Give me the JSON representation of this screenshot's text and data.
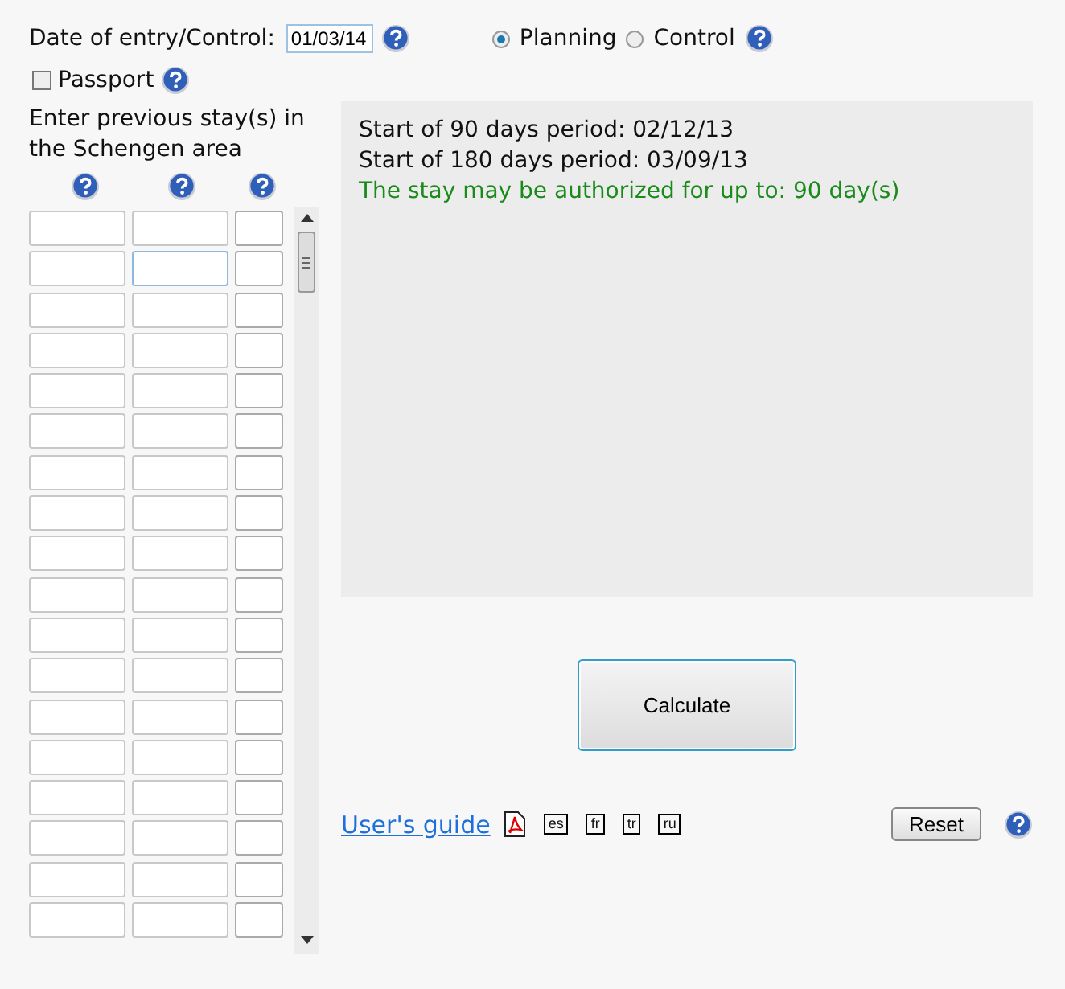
{
  "date_label": "Date of entry/Control:",
  "date_value": "01/03/14",
  "modes": [
    {
      "label": "Planning",
      "selected": true
    },
    {
      "label": "Control",
      "selected": false
    }
  ],
  "passport": {
    "label": "Passport",
    "checked": false
  },
  "stays_label": "Enter previous stay(s) in the Schengen area",
  "stay_rows": [
    {
      "fields": [
        {
          "focused": false
        },
        {
          "focused": false
        },
        {
          "focused": false
        }
      ]
    },
    {
      "fields": [
        {
          "focused": false
        },
        {
          "focused": true
        },
        {
          "focused": false
        }
      ]
    },
    {
      "fields": [
        {
          "focused": false
        },
        {
          "focused": false
        },
        {
          "focused": false
        }
      ]
    },
    {
      "fields": [
        {
          "focused": false
        },
        {
          "focused": false
        },
        {
          "focused": false
        }
      ]
    },
    {
      "fields": [
        {
          "focused": false
        },
        {
          "focused": false
        },
        {
          "focused": false
        }
      ]
    },
    {
      "fields": [
        {
          "focused": false
        },
        {
          "focused": false
        },
        {
          "focused": false
        }
      ]
    },
    {
      "fields": [
        {
          "focused": false
        },
        {
          "focused": false
        },
        {
          "focused": false
        }
      ]
    },
    {
      "fields": [
        {
          "focused": false
        },
        {
          "focused": false
        },
        {
          "focused": false
        }
      ]
    },
    {
      "fields": [
        {
          "focused": false
        },
        {
          "focused": false
        },
        {
          "focused": false
        }
      ]
    },
    {
      "fields": [
        {
          "focused": false
        },
        {
          "focused": false
        },
        {
          "focused": false
        }
      ]
    },
    {
      "fields": [
        {
          "focused": false
        },
        {
          "focused": false
        },
        {
          "focused": false
        }
      ]
    },
    {
      "fields": [
        {
          "focused": false
        },
        {
          "focused": false
        },
        {
          "focused": false
        }
      ]
    },
    {
      "fields": [
        {
          "focused": false
        },
        {
          "focused": false
        },
        {
          "focused": false
        }
      ]
    },
    {
      "fields": [
        {
          "focused": false
        },
        {
          "focused": false
        },
        {
          "focused": false
        }
      ]
    },
    {
      "fields": [
        {
          "focused": false
        },
        {
          "focused": false
        },
        {
          "focused": false
        }
      ]
    },
    {
      "fields": [
        {
          "focused": false
        },
        {
          "focused": false
        },
        {
          "focused": false
        }
      ]
    },
    {
      "fields": [
        {
          "focused": false
        },
        {
          "focused": false
        },
        {
          "focused": false
        }
      ]
    },
    {
      "fields": [
        {
          "focused": false
        },
        {
          "focused": false
        },
        {
          "focused": false
        }
      ]
    }
  ],
  "results": [
    {
      "text": "Start of 90 days period: 02/12/13",
      "kind": "info"
    },
    {
      "text": "Start of 180 days period: 03/09/13",
      "kind": "info"
    },
    {
      "text": "The stay may be authorized for up to: 90 day(s)",
      "kind": "success"
    }
  ],
  "calculate_button": "Calculate",
  "guide_link": "User's guide",
  "languages": [
    "es",
    "fr",
    "tr",
    "ru"
  ],
  "reset_button": "Reset"
}
